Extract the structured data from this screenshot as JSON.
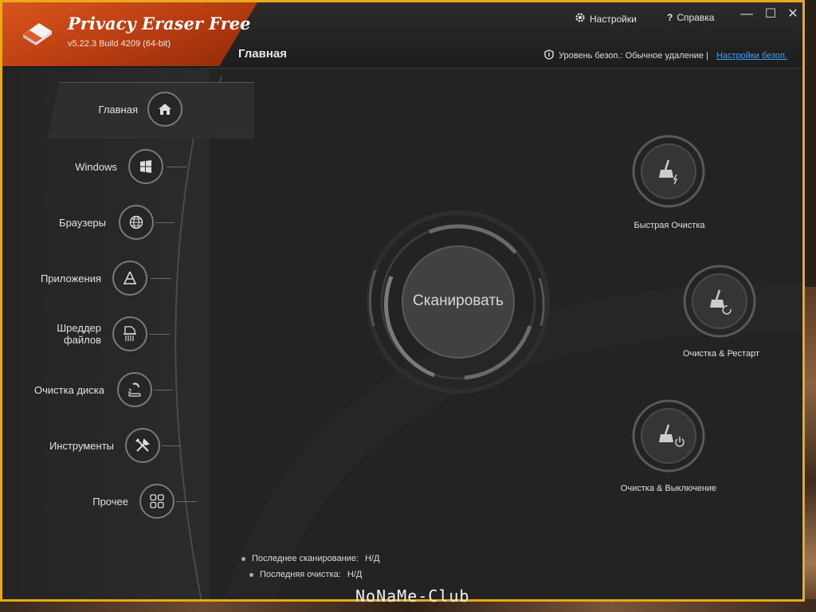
{
  "app": {
    "title": "Privacy Eraser Free",
    "version": "v5.22.3 Build 4209 (64-bit)",
    "section_title": "Главная"
  },
  "topbar": {
    "settings_label": "Настройки",
    "help_label": "Справка",
    "security_text": "Уровень безоп.: Обычное удаление |",
    "security_link": "Настройки безоп."
  },
  "nav": {
    "items": [
      {
        "label": "Главная",
        "icon": "home-icon"
      },
      {
        "label": "Windows",
        "icon": "windows-icon"
      },
      {
        "label": "Браузеры",
        "icon": "globe-icon"
      },
      {
        "label": "Приложения",
        "icon": "apps-icon"
      },
      {
        "label": "Шреддер",
        "label2": "файлов",
        "icon": "shredder-icon"
      },
      {
        "label": "Очистка диска",
        "icon": "disk-clean-icon"
      },
      {
        "label": "Инструменты",
        "icon": "tools-icon"
      },
      {
        "label": "Прочее",
        "icon": "grid-icon"
      }
    ]
  },
  "main": {
    "scan_label": "Сканировать",
    "quick_clean_label": "Быстрая Очистка",
    "clean_restart_label": "Очистка & Рестарт",
    "clean_shutdown_label": "Очистка & Выключение",
    "last_scan_label": "Последнее сканирование:",
    "last_scan_value": "Н/Д",
    "last_clean_label": "Последняя очистка:",
    "last_clean_value": "Н/Д"
  },
  "watermark": "NoNaMe-Club",
  "colors": {
    "brand": "#c9461a",
    "window_border": "#e9a91b",
    "link": "#3aa0ff",
    "background": "#232323"
  }
}
